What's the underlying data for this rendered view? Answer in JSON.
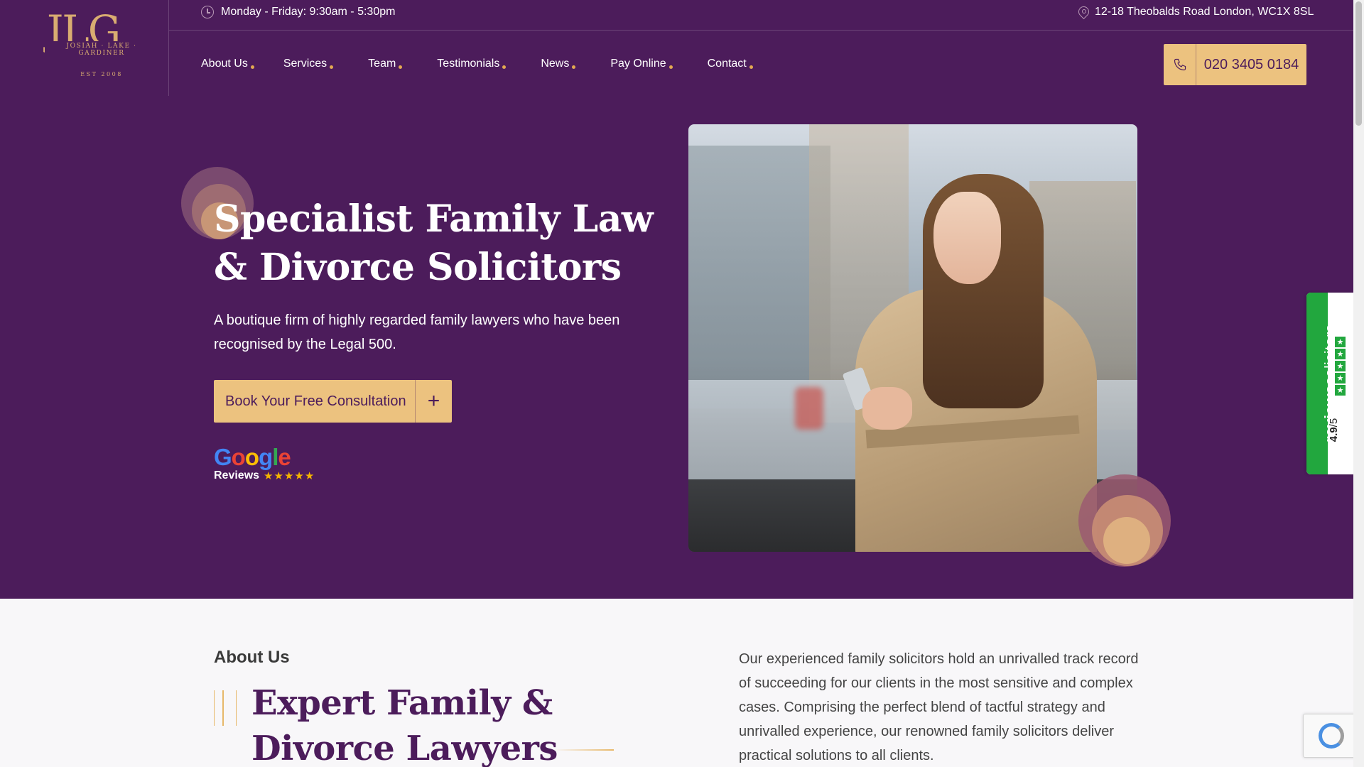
{
  "brand": {
    "logo_mark": "JLG",
    "logo_sub": "JOSIAH · LAKE · GARDINER",
    "logo_est": "EST 2008"
  },
  "topbar": {
    "hours": "Monday - Friday: 9:30am - 5:30pm",
    "address": "12-18 Theobalds Road London, WC1X 8SL"
  },
  "nav": {
    "items": [
      {
        "label": "About Us"
      },
      {
        "label": "Services"
      },
      {
        "label": "Team"
      },
      {
        "label": "Testimonials"
      },
      {
        "label": "News"
      },
      {
        "label": "Pay Online"
      },
      {
        "label": "Contact"
      }
    ],
    "phone": "020 3405 0184"
  },
  "hero": {
    "title": "Specialist Family Law & Divorce Solicitors",
    "subtitle": "A boutique firm of highly regarded family lawyers who have been recognised by the Legal 500.",
    "cta_label": "Book Your Free Consultation",
    "cta_icon": "+",
    "google_word": "Google",
    "google_reviews": "Reviews",
    "google_stars": "★★★★★"
  },
  "review_widget": {
    "brand_bold": "reviews",
    "brand_rest": "olicitors",
    "score": "4.9",
    "score_suffix": "/5"
  },
  "about": {
    "label": "About Us",
    "title": "Expert Family & Divorce Lawyers",
    "text": "Our experienced family solicitors hold an unrivalled track record of succeeding for our clients in the most sensitive and complex cases. Comprising the perfect blend of tactful strategy and unrivalled experience, our renowned family solicitors deliver practical solutions to all clients."
  },
  "colors": {
    "brand_purple": "#4c1c5b",
    "gold": "#ecc27f",
    "accent_dot": "#e3a951",
    "widget_green": "#22a73e"
  },
  "icons": [
    "clock-icon",
    "map-pin-icon",
    "phone-icon",
    "plus-icon",
    "star-icon",
    "recaptcha-icon"
  ]
}
